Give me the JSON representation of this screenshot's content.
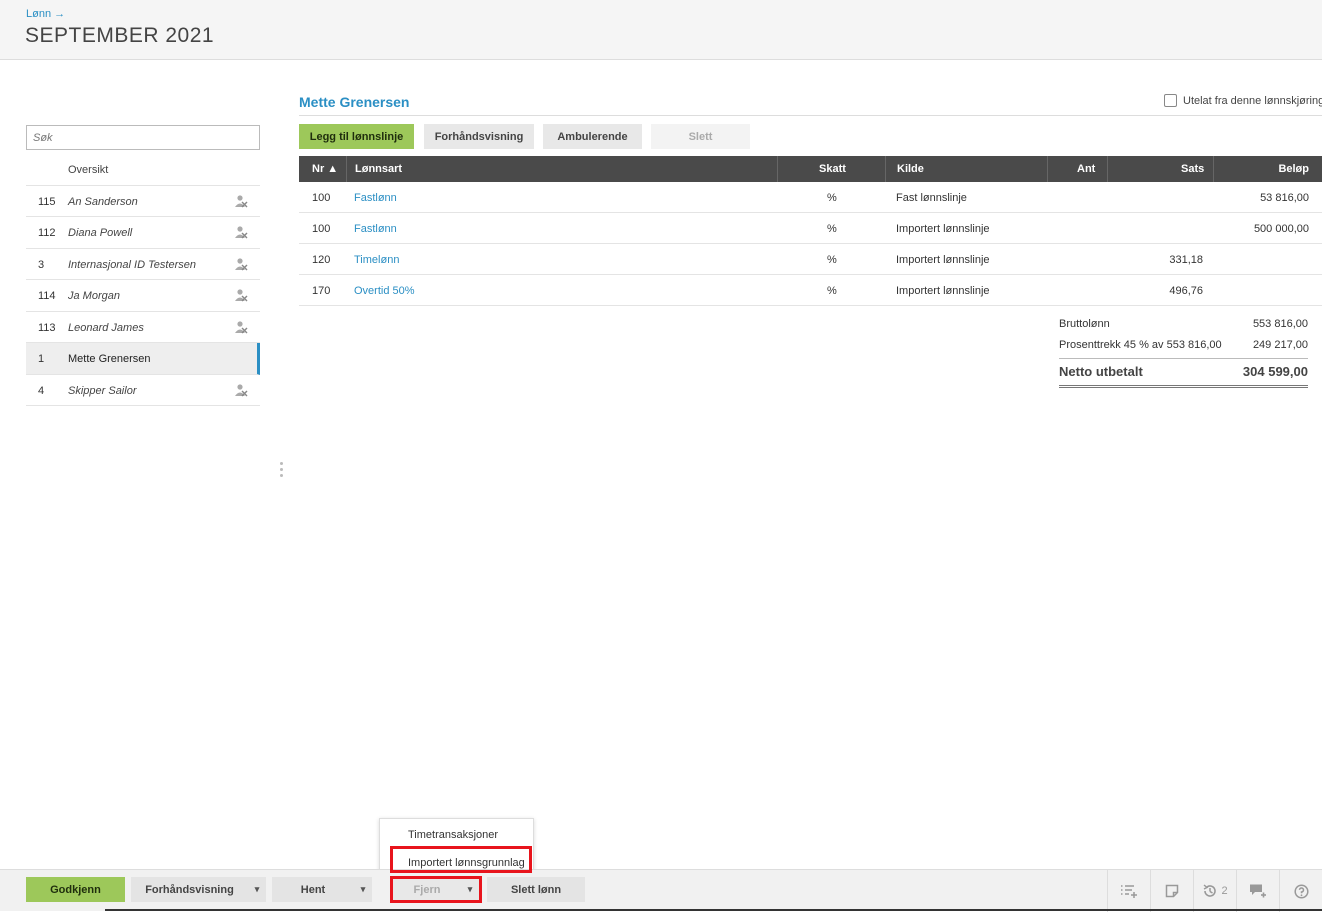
{
  "header": {
    "breadcrumb": "Lønn →",
    "title": "SEPTEMBER 2021"
  },
  "sidebar": {
    "search_placeholder": "Søk",
    "overview_label": "Oversikt",
    "employees": [
      {
        "nr": "115",
        "name": "An Sanderson"
      },
      {
        "nr": "112",
        "name": "Diana Powell"
      },
      {
        "nr": "3",
        "name": "Internasjonal ID Testersen"
      },
      {
        "nr": "114",
        "name": "Ja Morgan"
      },
      {
        "nr": "113",
        "name": "Leonard James"
      },
      {
        "nr": "1",
        "name": "Mette Grenersen"
      },
      {
        "nr": "4",
        "name": "Skipper Sailor"
      }
    ]
  },
  "main": {
    "employee_name": "Mette Grenersen",
    "exclude_label": "Utelat fra denne lønnskjøring",
    "actions": {
      "add_line": "Legg til lønnslinje",
      "preview": "Forhåndsvisning",
      "ambulant": "Ambulerende",
      "delete": "Slett"
    },
    "table": {
      "headers": {
        "nr": "Nr ▲",
        "lonnsart": "Lønnsart",
        "skatt": "Skatt",
        "kilde": "Kilde",
        "ant": "Ant",
        "sats": "Sats",
        "belop": "Beløp"
      },
      "rows": [
        {
          "nr": "100",
          "lonnsart": "Fastlønn",
          "skatt": "%",
          "kilde": "Fast lønnslinje",
          "ant": "",
          "sats": "",
          "belop": "53 816,00"
        },
        {
          "nr": "100",
          "lonnsart": "Fastlønn",
          "skatt": "%",
          "kilde": "Importert lønnslinje",
          "ant": "",
          "sats": "",
          "belop": "500 000,00"
        },
        {
          "nr": "120",
          "lonnsart": "Timelønn",
          "skatt": "%",
          "kilde": "Importert lønnslinje",
          "ant": "",
          "sats": "331,18",
          "belop": ""
        },
        {
          "nr": "170",
          "lonnsart": "Overtid 50%",
          "skatt": "%",
          "kilde": "Importert lønnslinje",
          "ant": "",
          "sats": "496,76",
          "belop": ""
        }
      ]
    },
    "summary": {
      "gross_label": "Bruttolønn",
      "gross_value": "553 816,00",
      "tax_label": "Prosenttrekk 45 % av 553 816,00",
      "tax_value": "249 217,00",
      "net_label": "Netto utbetalt",
      "net_value": "304 599,00"
    }
  },
  "dropdown": {
    "items": [
      "Timetransaksjoner",
      "Importert lønnsgrunnlag"
    ]
  },
  "footer": {
    "approve": "Godkjenn",
    "preview": "Forhåndsvisning",
    "fetch": "Hent",
    "remove": "Fjern",
    "delete_salary": "Slett lønn",
    "history_count": "2"
  },
  "colors": {
    "accent": "#2b8fc4",
    "primary_button": "#9dc85a",
    "header_dark": "#4a4a4a",
    "highlight": "#e8141c"
  }
}
